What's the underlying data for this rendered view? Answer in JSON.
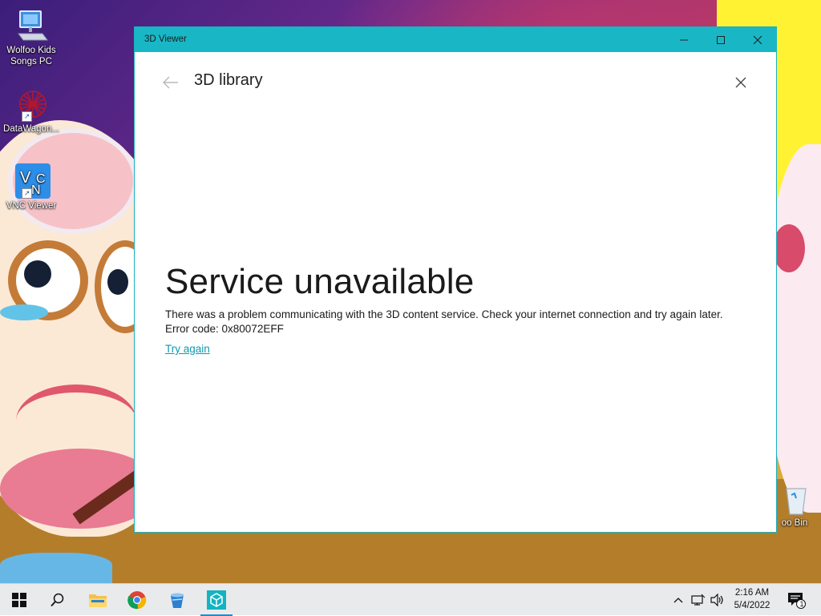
{
  "desktop": {
    "icons": [
      {
        "label": "Wolfoo Kids Songs PC",
        "icon": "computer-icon"
      },
      {
        "label": "DataWagon...",
        "icon": "datawagon-app-icon"
      },
      {
        "label": "VNC Viewer",
        "icon": "vnc-viewer-icon"
      },
      {
        "label": "oo Bin",
        "icon": "recycle-bin-icon"
      }
    ]
  },
  "window": {
    "title": "3D Viewer",
    "controls": [
      "minimize",
      "maximize",
      "close"
    ]
  },
  "page": {
    "title": "3D library",
    "error_title": "Service unavailable",
    "error_message": "There was a problem communicating with the 3D content service. Check your internet connection and try again later.",
    "error_code": "Error code: 0x80072EFF",
    "retry_label": "Try again"
  },
  "taskbar": {
    "pinned": [
      "start-icon",
      "search-icon",
      "file-explorer-icon",
      "chrome-icon",
      "paint-bucket-icon",
      "3d-viewer-icon"
    ],
    "active": "3d-viewer-icon",
    "tray": [
      "chevron-up-icon",
      "network-icon",
      "volume-icon"
    ],
    "time": "2:16 AM",
    "date": "5/4/2022",
    "notification_count": "1"
  },
  "colors": {
    "accent": "#19b7c6",
    "link": "#0f9ab0",
    "taskbar": "#e9eaeb"
  }
}
